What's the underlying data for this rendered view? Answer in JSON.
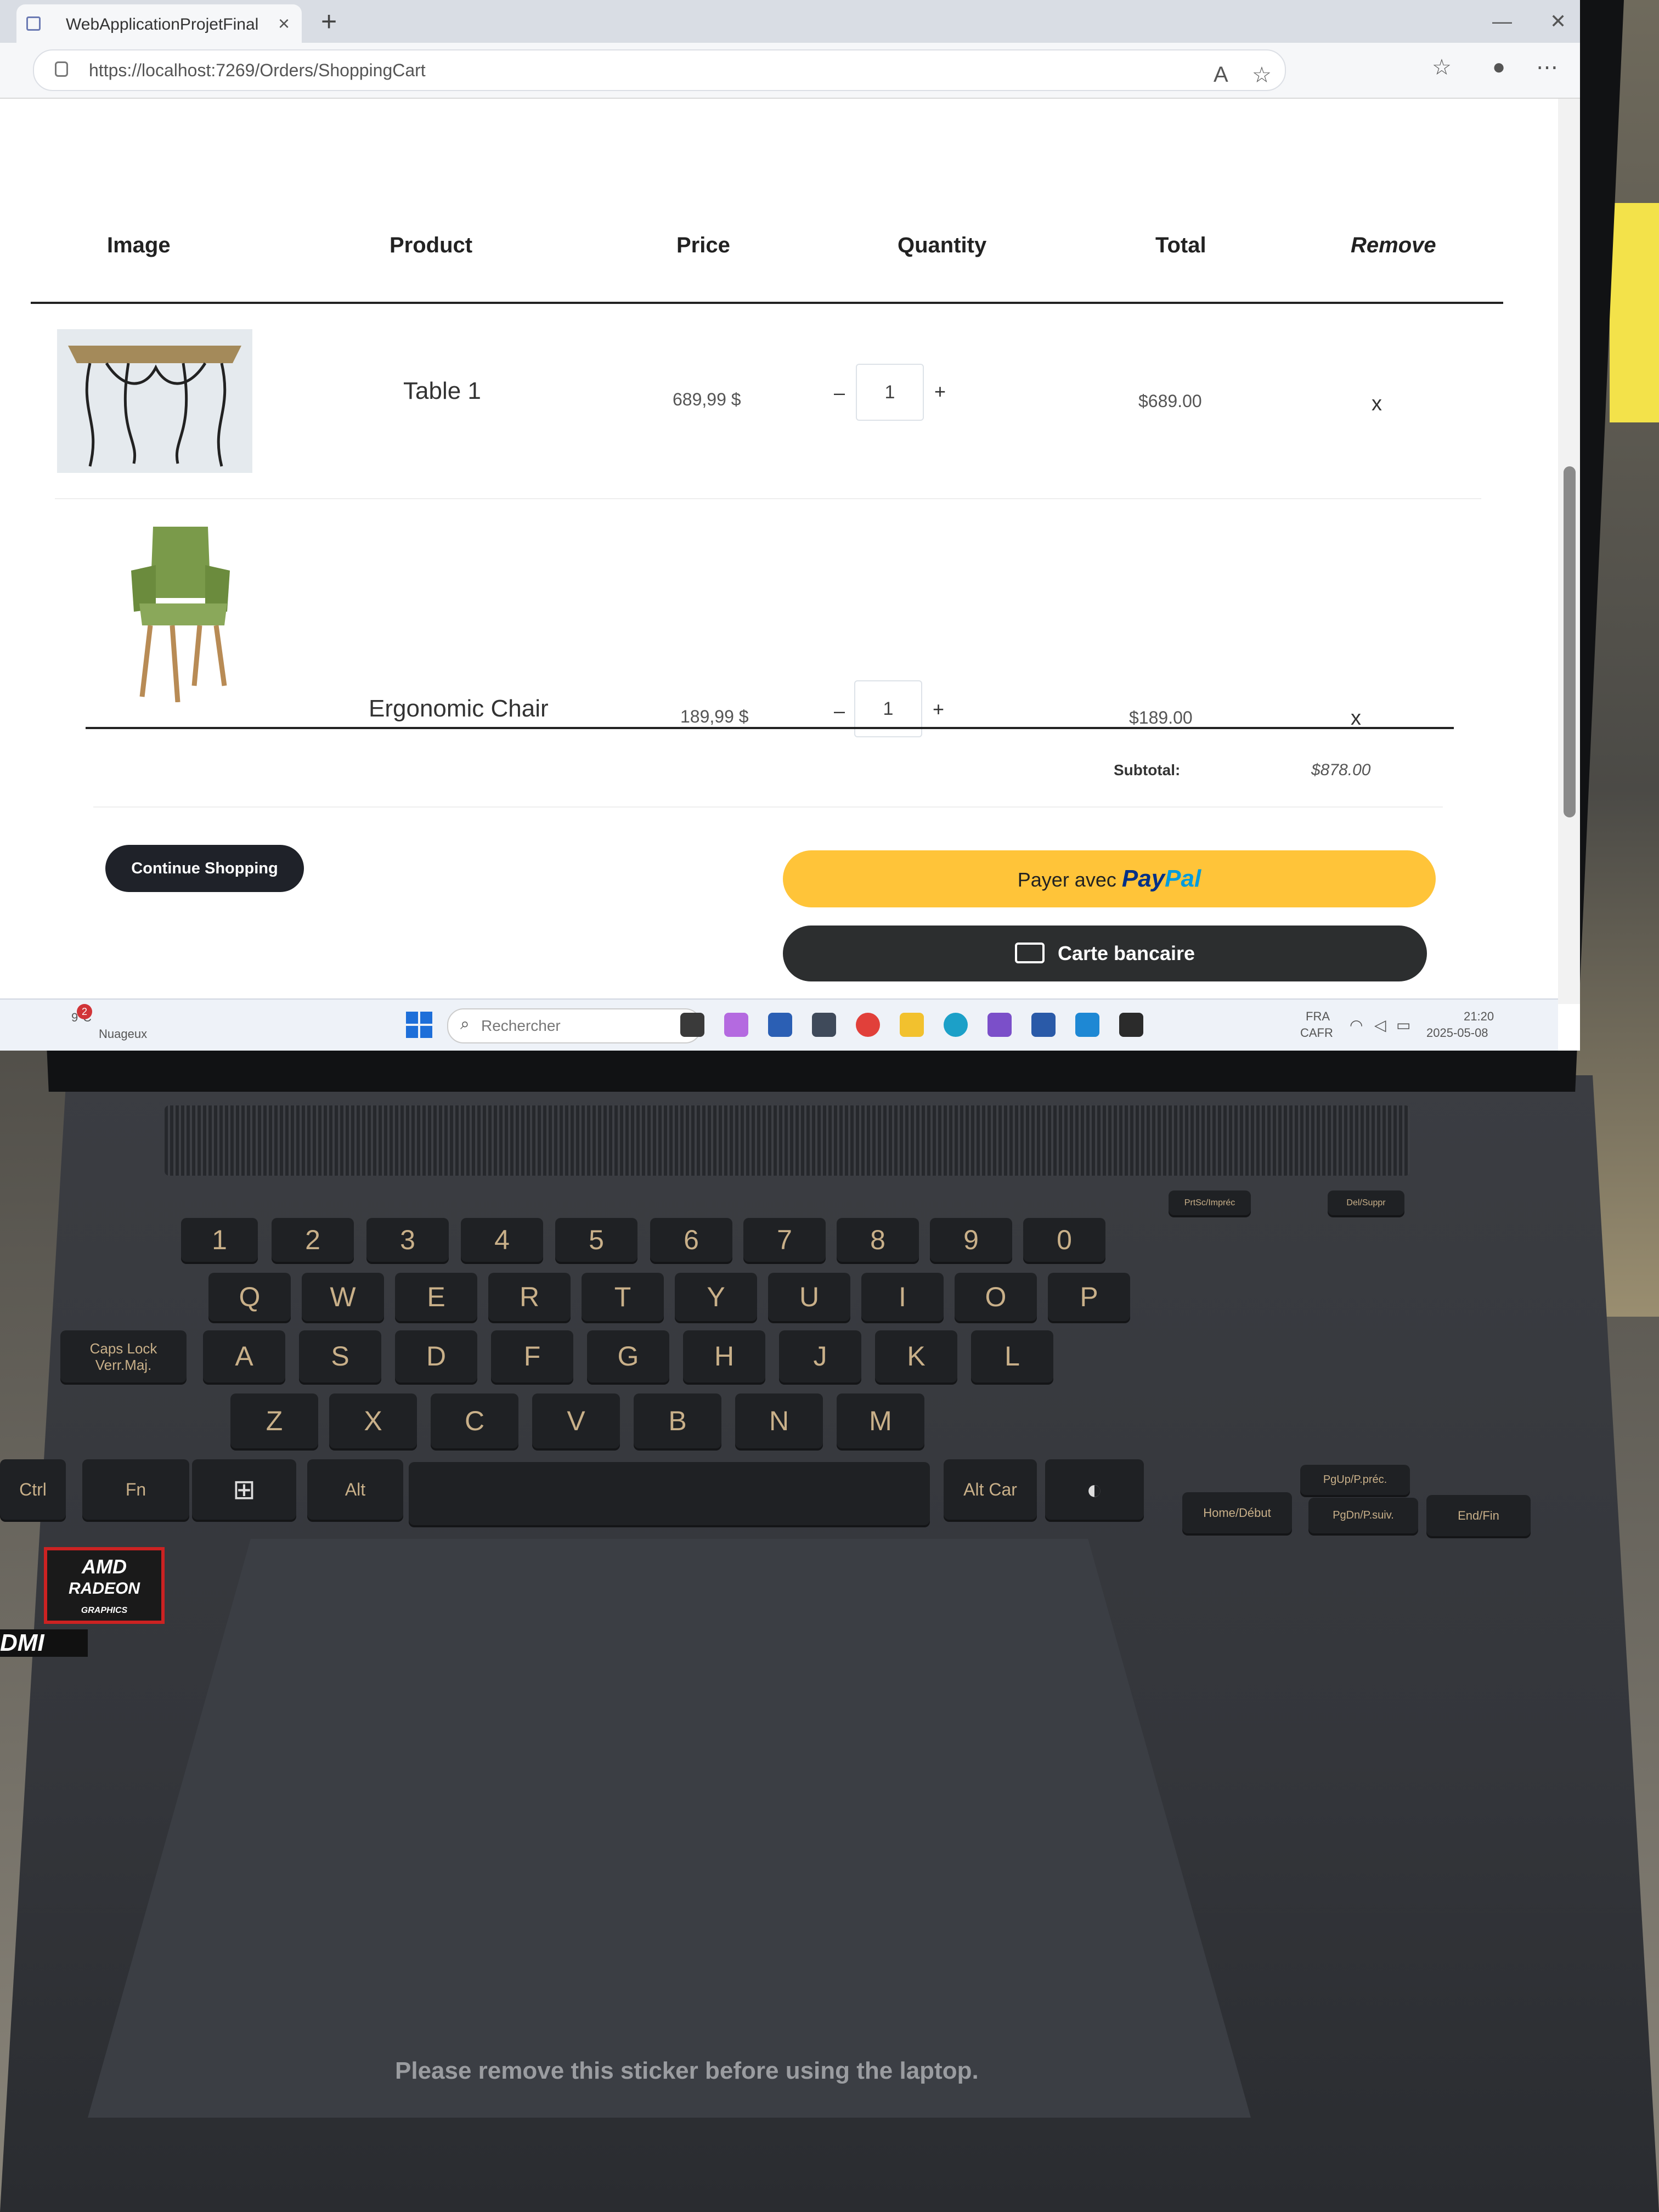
{
  "browser": {
    "tab_title": "WebApplicationProjetFinal",
    "url": "https://localhost:7269/Orders/ShoppingCart"
  },
  "cart": {
    "headers": [
      "Image",
      "Product",
      "Price",
      "Quantity",
      "Total",
      "Remove"
    ],
    "items": [
      {
        "name": "Table 1",
        "price": "689,99 $",
        "quantity": "1",
        "total": "$689.00",
        "remove": "x"
      },
      {
        "name": "Ergonomic Chair",
        "price": "189,99 $",
        "quantity": "1",
        "total": "$189.00",
        "remove": "x"
      }
    ],
    "subtotal_label": "Subtotal:",
    "subtotal_value": "$878.00",
    "qty_minus": "–",
    "qty_plus": "+"
  },
  "actions": {
    "continue_label": "Continue Shopping",
    "paypal_prefix": "Payer avec",
    "paypal_brand_a": "Pay",
    "paypal_brand_b": "Pal",
    "card_label": "Carte bancaire"
  },
  "taskbar": {
    "weather_temp": "9°C",
    "weather_desc": "Nuageux",
    "weather_badge": "2",
    "search_placeholder": "Rechercher",
    "lang_1": "FRA",
    "lang_2": "CAFR",
    "time": "21:20",
    "date": "2025-05-08"
  },
  "keyboard": {
    "row_numbers": [
      "1",
      "2",
      "3",
      "4",
      "5",
      "6",
      "7",
      "8",
      "9",
      "0"
    ],
    "row_q": [
      "Q",
      "W",
      "E",
      "R",
      "T",
      "Y",
      "U",
      "I",
      "O",
      "P"
    ],
    "row_a": [
      "A",
      "S",
      "D",
      "F",
      "G",
      "H",
      "J",
      "K",
      "L"
    ],
    "row_z": [
      "Z",
      "X",
      "C",
      "V",
      "B",
      "N",
      "M"
    ],
    "caps": "Caps Lock Verr.Maj.",
    "ctrl": "Ctrl",
    "fn": "Fn",
    "alt": "Alt",
    "altcar": "Alt Car",
    "home": "Home/Début",
    "pgup": "PgUp/P.préc.",
    "pgdn": "PgDn/P.suiv.",
    "end": "End/Fin",
    "prtsc": "PrtSc/Impréc",
    "del": "Del/Suppr"
  },
  "branding": {
    "amd_1": "AMD",
    "amd_2": "RADEON",
    "amd_3": "GRAPHICS",
    "hdmi": "DMI"
  },
  "sticker": "Please remove this sticker before using the laptop."
}
